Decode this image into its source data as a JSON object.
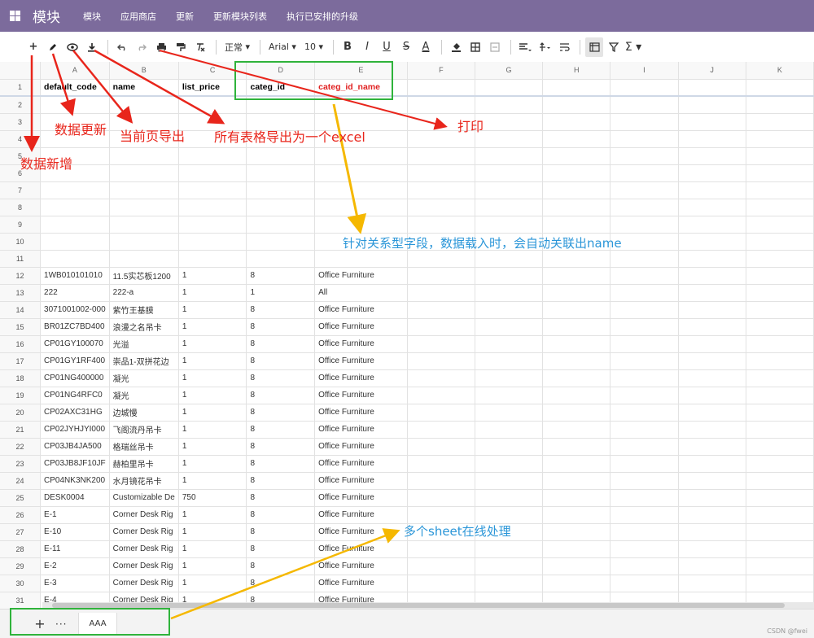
{
  "topbar": {
    "brand": "模块",
    "menu": [
      "模块",
      "应用商店",
      "更新",
      "更新模块列表",
      "执行已安排的升级"
    ]
  },
  "toolbar": {
    "font_format": "正常",
    "font_family": "Arial",
    "font_size": "10",
    "icons": [
      "add-icon",
      "edit-icon",
      "eye-icon",
      "download-icon",
      "undo-icon",
      "redo-icon",
      "print-icon",
      "paint-format-icon",
      "clear-format-icon",
      "bold-icon",
      "italic-icon",
      "underline-icon",
      "strikethrough-icon",
      "text-color-icon",
      "fill-color-icon",
      "borders-icon",
      "merge-icon",
      "align-icon",
      "valign-icon",
      "wrap-icon",
      "freeze-icon",
      "filter-icon",
      "sum-icon"
    ],
    "labels": {
      "bold": "B",
      "italic": "I",
      "underline": "U",
      "strike": "S",
      "text_color": "A",
      "sum": "Σ"
    }
  },
  "sheet": {
    "columns": [
      "A",
      "B",
      "C",
      "D",
      "E",
      "F",
      "G",
      "H",
      "I",
      "J",
      "K"
    ],
    "header_row": [
      "default_code",
      "name",
      "list_price",
      "categ_id",
      "categ_id_name",
      "",
      "",
      "",
      "",
      "",
      ""
    ],
    "empty_rows": [
      "2",
      "3",
      "4",
      "5",
      "6",
      "7",
      "8",
      "9",
      "10",
      "11"
    ],
    "data_rows": [
      {
        "n": "12",
        "a": "1WB010101010",
        "b": "11.5实芯板1200",
        "c": "1",
        "d": "8",
        "e": "Office Furniture"
      },
      {
        "n": "13",
        "a": "222",
        "b": "222-a",
        "c": "1",
        "d": "1",
        "e": "All"
      },
      {
        "n": "14",
        "a": "3071001002-000",
        "b": "紫竹王基膜",
        "c": "1",
        "d": "8",
        "e": "Office Furniture"
      },
      {
        "n": "15",
        "a": "BR01ZC7BD400",
        "b": "浪漫之名吊卡",
        "c": "1",
        "d": "8",
        "e": "Office Furniture"
      },
      {
        "n": "16",
        "a": "CP01GY100070",
        "b": "光溢",
        "c": "1",
        "d": "8",
        "e": "Office Furniture"
      },
      {
        "n": "17",
        "a": "CP01GY1RF400",
        "b": "崇品1-双拼花边",
        "c": "1",
        "d": "8",
        "e": "Office Furniture"
      },
      {
        "n": "18",
        "a": "CP01NG400000",
        "b": "凝光",
        "c": "1",
        "d": "8",
        "e": "Office Furniture"
      },
      {
        "n": "19",
        "a": "CP01NG4RFC0",
        "b": "凝光",
        "c": "1",
        "d": "8",
        "e": "Office Furniture"
      },
      {
        "n": "20",
        "a": "CP02AXC31HG",
        "b": "边城慢",
        "c": "1",
        "d": "8",
        "e": "Office Furniture"
      },
      {
        "n": "21",
        "a": "CP02JYHJYI000",
        "b": "飞阁流丹吊卡",
        "c": "1",
        "d": "8",
        "e": "Office Furniture"
      },
      {
        "n": "22",
        "a": "CP03JB4JA500",
        "b": "格瑞丝吊卡",
        "c": "1",
        "d": "8",
        "e": "Office Furniture"
      },
      {
        "n": "23",
        "a": "CP03JB8JF10JF",
        "b": "赫柏里吊卡",
        "c": "1",
        "d": "8",
        "e": "Office Furniture"
      },
      {
        "n": "24",
        "a": "CP04NK3NK200",
        "b": "水月镜花吊卡",
        "c": "1",
        "d": "8",
        "e": "Office Furniture"
      },
      {
        "n": "25",
        "a": "DESK0004",
        "b": "Customizable De",
        "c": "750",
        "d": "8",
        "e": "Office Furniture"
      },
      {
        "n": "26",
        "a": "E-1",
        "b": "Corner Desk Rig",
        "c": "1",
        "d": "8",
        "e": "Office Furniture"
      },
      {
        "n": "27",
        "a": "E-10",
        "b": "Corner Desk Rig",
        "c": "1",
        "d": "8",
        "e": "Office Furniture"
      },
      {
        "n": "28",
        "a": "E-11",
        "b": "Corner Desk Rig",
        "c": "1",
        "d": "8",
        "e": "Office Furniture"
      },
      {
        "n": "29",
        "a": "E-2",
        "b": "Corner Desk Rig",
        "c": "1",
        "d": "8",
        "e": "Office Furniture"
      },
      {
        "n": "30",
        "a": "E-3",
        "b": "Corner Desk Rig",
        "c": "1",
        "d": "8",
        "e": "Office Furniture"
      },
      {
        "n": "31",
        "a": "E-4",
        "b": "Corner Desk Rig",
        "c": "1",
        "d": "8",
        "e": "Office Furniture"
      }
    ]
  },
  "bottom": {
    "add": "+",
    "menu": "···",
    "sheet_tab": "AAA",
    "watermark": "CSDN @fwei"
  },
  "annotations": {
    "add": "数据新增",
    "update": "数据更新",
    "export_page": "当前页导出",
    "export_all": "所有表格导出为一个excel",
    "print": "打印",
    "relation": "针对关系型字段，数据载入时，会自动关联出name",
    "multi_sheet": "多个sheet在线处理"
  },
  "colors": {
    "topbar": "#7c6b9c",
    "annotation_red": "#e8251b",
    "annotation_blue": "#2b96d8",
    "highlight_box": "#2fb33b",
    "arrow_yellow": "#f5b800"
  }
}
